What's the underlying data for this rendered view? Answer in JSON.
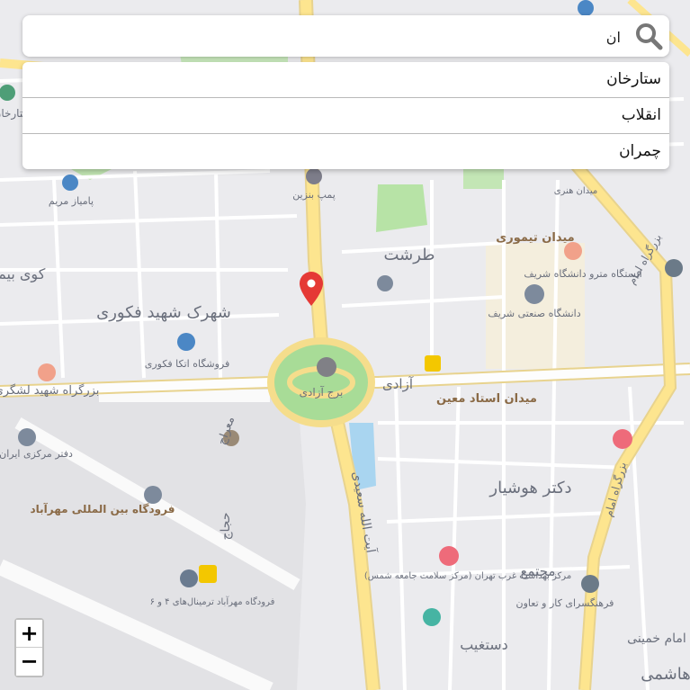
{
  "search": {
    "value": "ان",
    "icon": "search-icon"
  },
  "suggestions": [
    {
      "label": "ستارخان"
    },
    {
      "label": "انقلاب"
    },
    {
      "label": "چمران"
    }
  ],
  "zoom": {
    "in_label": "+",
    "out_label": "−"
  },
  "map": {
    "marker_icon": "location-pin-icon",
    "labels": {
      "sattarkhan": "ستارخان",
      "sharif_park": "پارک شریف",
      "pump_benzin": "پمپ بنزین",
      "parking": "پامیاز مریم",
      "meydan_honari": "میدان هنری",
      "tarasht": "طرشت",
      "meydan_teymouri": "میدان تیموری",
      "imam_hwy_top": "بزرگراه امام",
      "shariati_metro": "ایستگاه مترو دانشگاه شریف",
      "koy_bimeh": "کوی بیمه",
      "shahrak_fakouri": "شهرک شهید فکوری",
      "sharif_uni": "دانشگاه صنعتی شریف",
      "azadi_tower": "برج آزادی",
      "azadi_st": "آزادی",
      "ostad_moein": "میدان استاد معین",
      "etka_store": "فروشگاه اتکا فکوری",
      "lashgari_hwy": "بزرگراه شهید لشگری",
      "meraj": "معراج",
      "central_office": "دفتر مرکزی ایران",
      "mehrabad_airport": "فرودگاه بین المللی مهرآباد",
      "dr_houshyar": "دکتر هوشیار",
      "imam_hwy_bottom": "بزرگراه امام",
      "ayatollah_saeedi": "آیت الله سعیدی",
      "hajjaj": "حجاج",
      "terminal_airport": "فرودگاه مهرآباد ترمینال‌های ۴ و ۶",
      "health_center": "مرکز بهداشت غرب تهران (مرکز سلامت جامعه شمس)",
      "mojtame": "مجتمع",
      "farhangsara": "فرهنگسرای کار و تعاون",
      "dastgheib": "دستغیب",
      "imam_khomeini": "امام خمینی",
      "hashemi": "هاشمی"
    }
  }
}
